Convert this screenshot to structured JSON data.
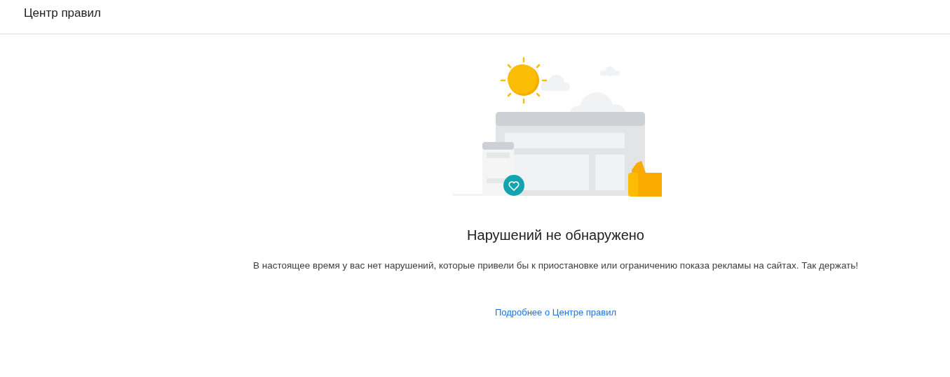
{
  "header": {
    "title": "Центр правил"
  },
  "empty_state": {
    "heading": "Нарушений не обнаружено",
    "message": "В настоящее время у вас нет нарушений, которые привели бы к приостановке или ограничению показа рекламы на сайтах. Так держать!",
    "link": "Подробнее о Центре правил"
  }
}
